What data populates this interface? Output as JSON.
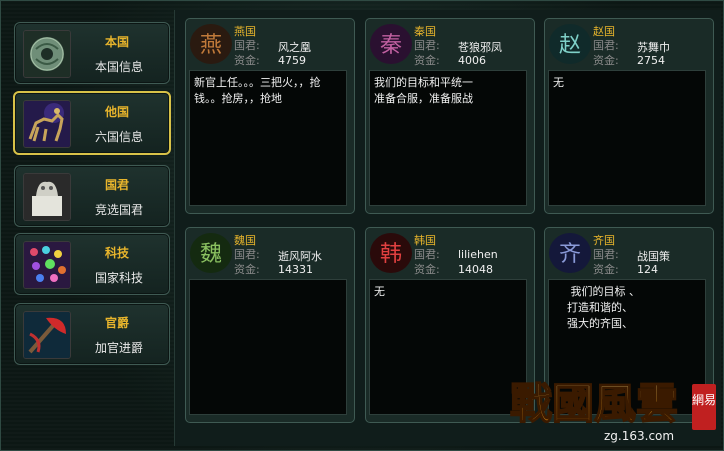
{
  "nav": [
    {
      "title": "本国",
      "sub": "本国信息",
      "icon": "jade-disc-icon",
      "active": false
    },
    {
      "title": "他国",
      "sub": "六国信息",
      "icon": "horse-rider-icon",
      "active": true
    },
    {
      "title": "国君",
      "sub": "竞选国君",
      "icon": "seal-icon",
      "active": false
    },
    {
      "title": "科技",
      "sub": "国家科技",
      "icon": "gems-icon",
      "active": false
    },
    {
      "title": "官爵",
      "sub": "加官进爵",
      "icon": "axe-icon",
      "active": false
    }
  ],
  "labels": {
    "ruler": "国君:",
    "funds": "资金:"
  },
  "states": [
    {
      "name": "燕国",
      "glyph": "燕",
      "ruler": "风之凰",
      "funds": "4759",
      "notice": "新官上任。。。三把火，，抢\n钱。。抢房，，抢地",
      "color": "#c07a3a"
    },
    {
      "name": "秦国",
      "glyph": "秦",
      "ruler": "苍狼邪凤",
      "funds": "4006",
      "notice": "我们的目标和平统一\n准备合服，准备服战",
      "color": "#b04a8a"
    },
    {
      "name": "赵国",
      "glyph": "赵",
      "ruler": "苏舞巾",
      "funds": "2754",
      "notice": "无",
      "color": "#5aa3a0"
    },
    {
      "name": "魏国",
      "glyph": "魏",
      "ruler": "逝风阿水",
      "funds": "14331",
      "notice": "",
      "color": "#6aa04a"
    },
    {
      "name": "韩国",
      "glyph": "韩",
      "ruler": "liliehen",
      "funds": "14048",
      "notice": "无",
      "color": "#c03030"
    },
    {
      "name": "齐国",
      "glyph": "齐",
      "ruler": "战国策",
      "funds": "124",
      "notice": "     我们的目标 、\n    打造和谐的、\n    强大的齐国、",
      "color": "#6a7ab0"
    }
  ],
  "logo": {
    "title": "戰國風雲",
    "url": "zg.163.com",
    "stamp": "網易"
  }
}
